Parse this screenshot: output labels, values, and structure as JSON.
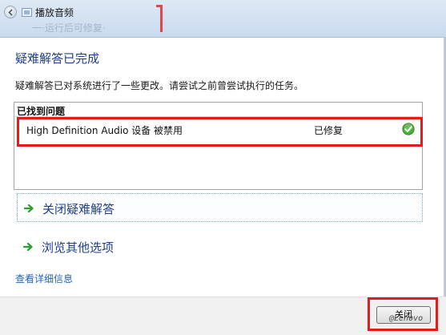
{
  "window": {
    "title": "播放音频",
    "background_text": "一·运行后可修复·"
  },
  "main": {
    "heading": "疑难解答已完成",
    "description": "疑难解答已对系统进行了一些更改。请尝试之前曾尝试执行的任务。"
  },
  "problems": {
    "header": "已找到问题",
    "items": [
      {
        "name": "High Definition Audio 设备 被禁用",
        "status": "已修复",
        "icon": "check-icon"
      }
    ]
  },
  "links": {
    "close_troubleshooter": "关闭疑难解答",
    "browse_other_options": "浏览其他选项",
    "view_details": "查看详细信息"
  },
  "footer": {
    "close_label": "关闭",
    "watermark": "@Lenovo"
  },
  "colors": {
    "heading": "#1e3f8e",
    "link": "#2463b8",
    "highlight": "#e31b1b",
    "check": "#3a9b2a"
  }
}
